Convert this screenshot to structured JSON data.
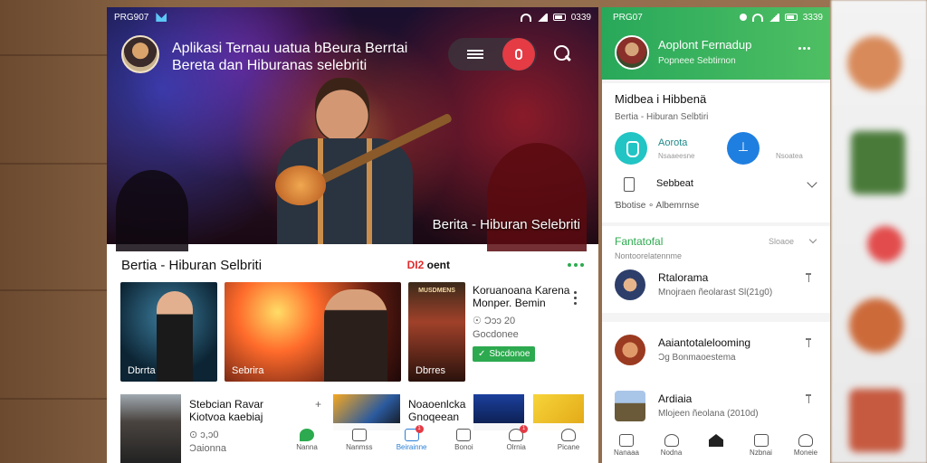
{
  "left_phone": {
    "status": {
      "carrier": "PRG907",
      "time": "0339"
    },
    "header": {
      "title_line1": "Aplikasi Ternau uatua bBeura Berrtai",
      "title_line2": "Bereta dan Hiburanas selebriti"
    },
    "hero_caption": "Berita - Hiburan Selebriti",
    "section": {
      "title": "Bertia - Hiburan Selbriti",
      "badge_prefix": "DI2",
      "badge_suffix": "oent"
    },
    "cards": [
      {
        "label": "Dbrrta"
      },
      {
        "label": "Sebrira"
      },
      {
        "label": "Dbrres",
        "poster_title": "MUSDMENS"
      }
    ],
    "mini": {
      "title": "Koruanoana Karena Monper. Bemin",
      "meta1": "☉ Ɔɔɔ 20",
      "meta2": "Gocdonee",
      "button": "Sbcdonoe"
    },
    "row2": {
      "title": "Stebcian Ravar Kiotvoa kaebiaj",
      "meta1": "⊙ ɔ,ɔ0",
      "meta2": "Ɔaionna",
      "plus": "+",
      "thumb_title": "Noaoenlcka Gnoqeean"
    },
    "nav": [
      {
        "label": "Nanna",
        "icon": "green-home-icon"
      },
      {
        "label": "Nanmss",
        "icon": "chat-icon"
      },
      {
        "label": "Beirainne",
        "icon": "play-icon",
        "badge": "1"
      },
      {
        "label": "Bonoi",
        "icon": "bag-icon"
      },
      {
        "label": "Olrnia",
        "icon": "clock-icon",
        "badge": "1"
      },
      {
        "label": "Picane",
        "icon": "profile-icon"
      }
    ]
  },
  "right_phone": {
    "status": {
      "carrier": "PRG07",
      "time": "3339"
    },
    "header": {
      "title": "Aoplont Fernadup",
      "subtitle": "Popneee Sebtirnon"
    },
    "card1": {
      "title": "Midbea i Hibbenä",
      "subtitle": "Bertia - Hiburan Selbtiri",
      "teal_label": "Aorota",
      "teal_sub": "Nsaaeesne",
      "blue_sub": "Nsoatea",
      "select_label": "Sebbeat",
      "footer": "Ɓbotise ∘ Albemrnse"
    },
    "card2": {
      "title": "Fantatofal",
      "right": "Sloaoe",
      "subtitle": "Nontoorelatennme"
    },
    "items": [
      {
        "title": "Rtalorama",
        "subtitle": "Mnojraen ñeolarast Sl(21g0)"
      },
      {
        "title": "Aaiantotalelooming",
        "subtitle": "Ɔg Bonmaoestema"
      },
      {
        "title": "Ardiaia",
        "subtitle": "Mlojeen ñeolana (2010d)"
      }
    ],
    "nav": [
      {
        "label": "Nanaaa",
        "icon": "home-icon"
      },
      {
        "label": "Nodna",
        "icon": "search-icon"
      },
      {
        "label": "",
        "icon": "home-active-icon"
      },
      {
        "label": "Nzbnai",
        "icon": "tv-icon"
      },
      {
        "label": "Moneie",
        "icon": "profile-icon"
      }
    ]
  }
}
